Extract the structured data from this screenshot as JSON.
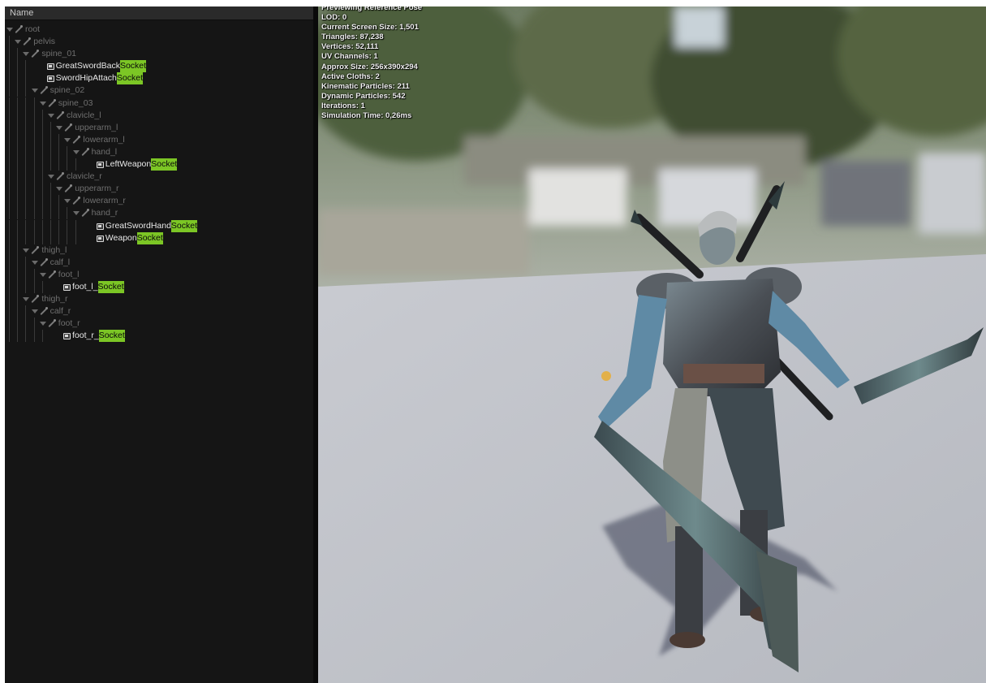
{
  "tree": {
    "header": "Name",
    "rows": [
      {
        "depth": 0,
        "type": "bone",
        "name": "root"
      },
      {
        "depth": 1,
        "type": "bone",
        "name": "pelvis"
      },
      {
        "depth": 2,
        "type": "bone",
        "name": "spine_01"
      },
      {
        "depth": 3,
        "type": "socket",
        "name": "GreatSwordBack",
        "suffix": "Socket"
      },
      {
        "depth": 3,
        "type": "socket",
        "name": "SwordHipAttach",
        "suffix": "Socket"
      },
      {
        "depth": 3,
        "type": "bone",
        "name": "spine_02"
      },
      {
        "depth": 4,
        "type": "bone",
        "name": "spine_03"
      },
      {
        "depth": 5,
        "type": "bone",
        "name": "clavicle_l"
      },
      {
        "depth": 6,
        "type": "bone",
        "name": "upperarm_l"
      },
      {
        "depth": 7,
        "type": "bone",
        "name": "lowerarm_l"
      },
      {
        "depth": 8,
        "type": "bone",
        "name": "hand_l"
      },
      {
        "depth": 9,
        "type": "socket",
        "name": "LeftWeapon",
        "suffix": "Socket"
      },
      {
        "depth": 5,
        "type": "bone",
        "name": "clavicle_r"
      },
      {
        "depth": 6,
        "type": "bone",
        "name": "upperarm_r"
      },
      {
        "depth": 7,
        "type": "bone",
        "name": "lowerarm_r"
      },
      {
        "depth": 8,
        "type": "bone",
        "name": "hand_r"
      },
      {
        "depth": 9,
        "type": "socket",
        "name": "GreatSwordHand",
        "suffix": "Socket"
      },
      {
        "depth": 9,
        "type": "socket",
        "name": "Weapon",
        "suffix": "Socket"
      },
      {
        "depth": 2,
        "type": "bone",
        "name": "thigh_l"
      },
      {
        "depth": 3,
        "type": "bone",
        "name": "calf_l"
      },
      {
        "depth": 4,
        "type": "bone",
        "name": "foot_l"
      },
      {
        "depth": 5,
        "type": "socket",
        "name": "foot_l_",
        "suffix": "Socket"
      },
      {
        "depth": 2,
        "type": "bone",
        "name": "thigh_r"
      },
      {
        "depth": 3,
        "type": "bone",
        "name": "calf_r"
      },
      {
        "depth": 4,
        "type": "bone",
        "name": "foot_r"
      },
      {
        "depth": 5,
        "type": "socket",
        "name": "foot_r_",
        "suffix": "Socket"
      }
    ]
  },
  "viewport": {
    "stats": [
      "Previewing Reference Pose",
      "LOD: 0",
      "Current Screen Size: 1,501",
      "Triangles: 87,238",
      "Vertices: 52,111",
      "UV Channels: 1",
      "Approx Size: 256x390x294",
      "Active Cloths: 2",
      "Kinematic Particles: 211",
      "Dynamic Particles: 542",
      "Iterations: 1",
      "Simulation Time: 0,26ms"
    ]
  },
  "colors": {
    "panel_bg": "#151515",
    "highlight": "#7cc625",
    "floor": "#c2c4ca"
  }
}
